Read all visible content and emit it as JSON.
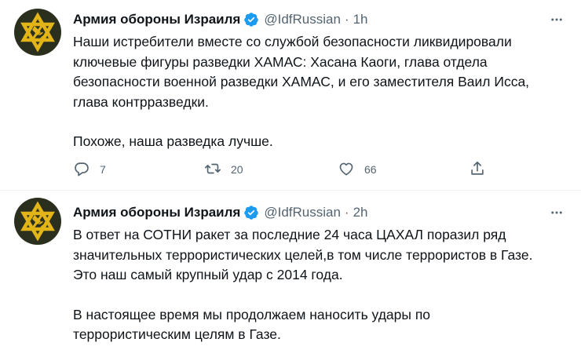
{
  "tweets": [
    {
      "author": "Армия обороны Израиля",
      "handle": "@IdfRussian",
      "separator": "·",
      "time": "1h",
      "paragraphs": [
        [
          "Наши истребители вместе со службой безопасности ликвидировали",
          "ключевые фигуры разведки ХАМАС: Хасана Каоги, глава отдела",
          "безопасности военной разведки ХАМАС, и его заместителя Ваил Исса,",
          "глава контрразведки."
        ],
        [
          "Похоже, наша разведка лучше."
        ]
      ],
      "replies": "7",
      "retweets": "20",
      "likes": "66"
    },
    {
      "author": "Армия обороны Израиля",
      "handle": "@IdfRussian",
      "separator": "·",
      "time": "2h",
      "paragraphs": [
        [
          "В ответ на СОТНИ ракет за последние 24 часа ЦАХАЛ поразил ряд",
          "значительных террористических целей,в том числе террористов в Газе.",
          "Это наш самый крупный удар с 2014 года."
        ],
        [
          "В настоящее время мы продолжаем наносить удары по",
          "террористическим целям в Газе."
        ]
      ]
    }
  ],
  "colors": {
    "text": "#0f1419",
    "secondary": "#536471",
    "verified": "#1d9bf0",
    "avatar_bg": "#2b2f1d",
    "emblem": "#e3b417",
    "divider": "#eff3f4"
  },
  "icons": {
    "verified": "verified-badge-icon",
    "more": "more-dots-icon",
    "reply": "reply-icon",
    "retweet": "retweet-icon",
    "like": "like-icon",
    "share": "share-icon"
  }
}
